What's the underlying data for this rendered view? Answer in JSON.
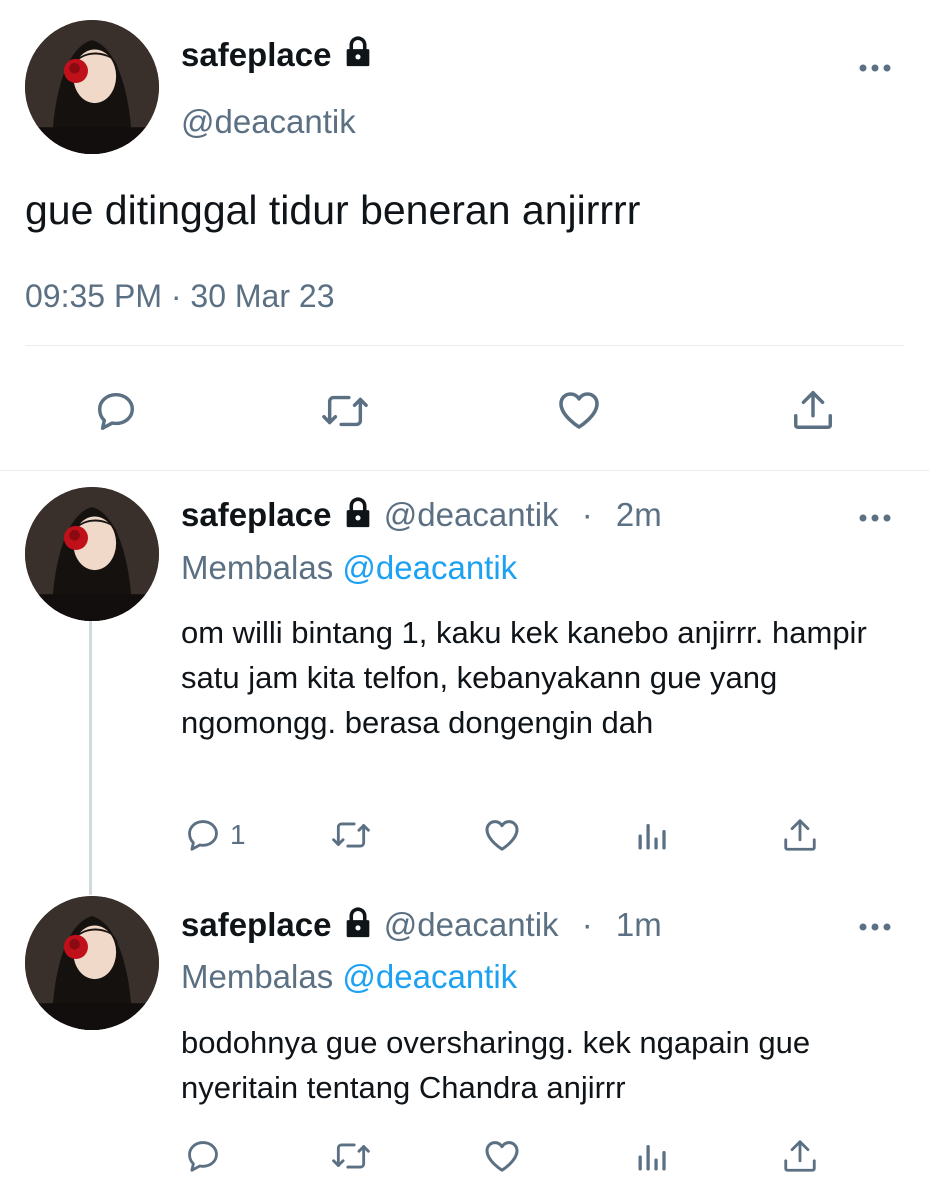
{
  "main_tweet": {
    "display_name": "safeplace",
    "handle": "@deacantik",
    "text": "gue ditinggal tidur beneran anjirrrr",
    "timestamp": "09:35 PM · 30 Mar 23"
  },
  "replies": [
    {
      "display_name": "safeplace",
      "handle": "@deacantik",
      "separator": "·",
      "time_ago": "2m",
      "replying_prefix": "Membalas",
      "replying_to": "@deacantik",
      "text": "om willi bintang 1, kaku kek kanebo anjirrr. hampir satu jam kita telfon, kebanyakann gue yang ngomongg. berasa dongengin dah",
      "reply_count": "1"
    },
    {
      "display_name": "safeplace",
      "handle": "@deacantik",
      "separator": "·",
      "time_ago": "1m",
      "replying_prefix": "Membalas",
      "replying_to": "@deacantik",
      "text": "bodohnya gue oversharingg. kek ngapain gue nyeritain tentang Chandra anjirrr",
      "reply_count": ""
    }
  ],
  "colors": {
    "text": "#0f1419",
    "secondary": "#5b7083",
    "link": "#1da1f2",
    "divider": "#e6ecf0",
    "thread_line": "#cfd9de"
  },
  "icons": [
    "lock-icon",
    "more-icon",
    "reply-icon",
    "retweet-icon",
    "like-icon",
    "analytics-icon",
    "share-icon"
  ]
}
